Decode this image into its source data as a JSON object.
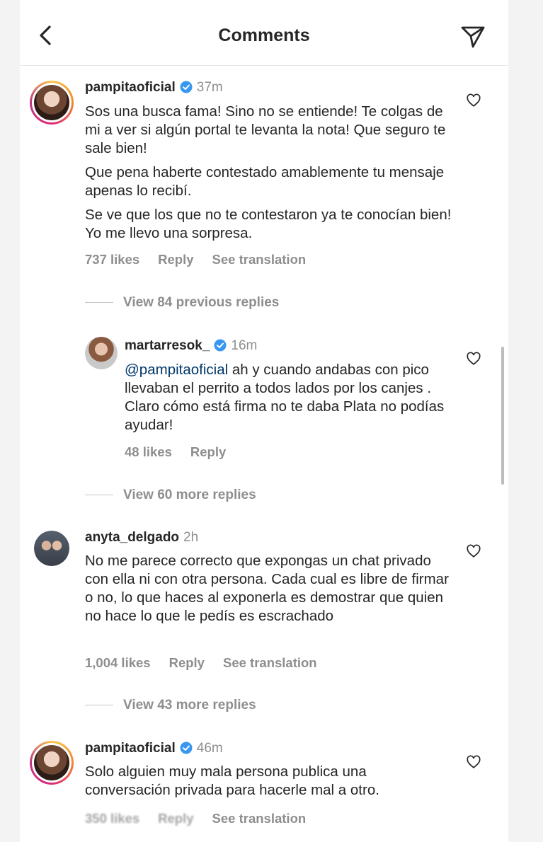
{
  "header": {
    "title": "Comments",
    "back_icon": "chevron-left-icon",
    "send_icon": "paper-plane-icon"
  },
  "comments": [
    {
      "username": "pampitaoficial",
      "verified": true,
      "time": "37m",
      "paragraphs": [
        "Sos una busca fama! Sino no se entiende! Te colgas de mi a ver si algún portal te levanta la nota! Que seguro te sale bien!",
        "Que pena haberte contestado amablemente tu mensaje apenas lo recibí.",
        "Se ve que los que no te contestaron ya te conocían bien! Yo me llevo una sorpresa."
      ],
      "likes": "737 likes",
      "reply": "Reply",
      "translation": "See translation",
      "view_replies": "View 84 previous replies"
    },
    {
      "username": "martarresok_",
      "verified": true,
      "time": "16m",
      "mention": "@pampitaoficial",
      "text": " ah y cuando andabas con pico llevaban el perrito a todos lados por los canjes . Claro cómo está firma no te daba Plata no podías ayudar!",
      "likes": "48 likes",
      "reply": "Reply",
      "view_replies": "View 60 more replies"
    },
    {
      "username": "anyta_delgado",
      "verified": false,
      "time": "2h",
      "text": "No me parece correcto que expongas un chat privado con ella ni con otra persona. Cada cual es libre de firmar o no, lo que haces al exponerla es demostrar que quien no hace lo que le pedís es escrachado",
      "likes": "1,004 likes",
      "reply": "Reply",
      "translation": "See translation",
      "view_replies": "View 43 more replies"
    },
    {
      "username": "pampitaoficial",
      "verified": true,
      "time": "46m",
      "text": "Solo alguien muy mala persona publica una conversación privada para hacerle mal a otro.",
      "likes": "350 likes",
      "reply": "Reply",
      "translation": "See translation"
    }
  ],
  "colors": {
    "verified": "#3897f0",
    "muted": "#8e8e8e",
    "mention": "#00376b"
  }
}
